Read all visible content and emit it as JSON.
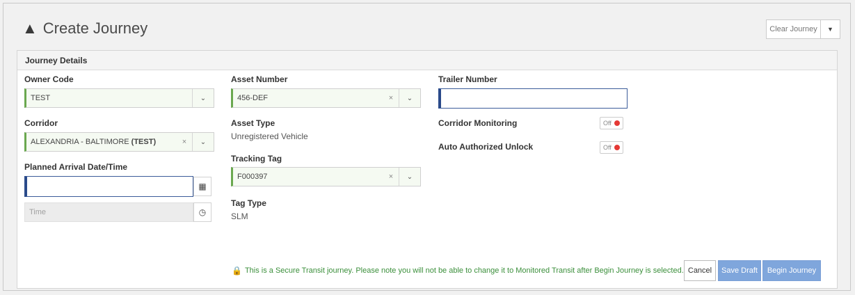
{
  "header": {
    "title": "Create Journey",
    "title_icon": "road-icon",
    "clear_label": "Clear Journey",
    "clear_caret": "▼"
  },
  "panel": {
    "title": "Journey Details"
  },
  "fields": {
    "owner_code": {
      "label": "Owner Code",
      "value": "TEST"
    },
    "corridor": {
      "label": "Corridor",
      "value_main": "ALEXANDRIA - BALTIMORE",
      "value_bold": "(TEST)"
    },
    "planned_arrival": {
      "label": "Planned Arrival Date/Time",
      "date_value": "",
      "time_placeholder": "Time"
    },
    "asset_number": {
      "label": "Asset Number",
      "value": "456-DEF"
    },
    "asset_type": {
      "label": "Asset Type",
      "value": "Unregistered Vehicle"
    },
    "tracking_tag": {
      "label": "Tracking Tag",
      "value": "F000397"
    },
    "tag_type": {
      "label": "Tag Type",
      "value": "SLM"
    },
    "trailer_number": {
      "label": "Trailer Number",
      "value": ""
    },
    "corridor_monitoring": {
      "label": "Corridor Monitoring",
      "state": "Off"
    },
    "auto_unlock": {
      "label": "Auto Authorized Unlock",
      "state": "Off"
    }
  },
  "footer": {
    "notice": "This is a Secure Transit journey. Please note you will not be able to change it to Monitored Transit after Begin Journey is selected.",
    "cancel_label": "Cancel",
    "save_label": "Save Draft",
    "begin_label": "Begin Journey"
  },
  "glyphs": {
    "clear": "×",
    "dropdown": "⌄",
    "calendar": "▦",
    "clock": "◷",
    "lock": "🔒"
  },
  "colors": {
    "accent_green": "#6aa84f",
    "primary_blue": "#7fa6dc",
    "toggle_off": "#e53935"
  }
}
